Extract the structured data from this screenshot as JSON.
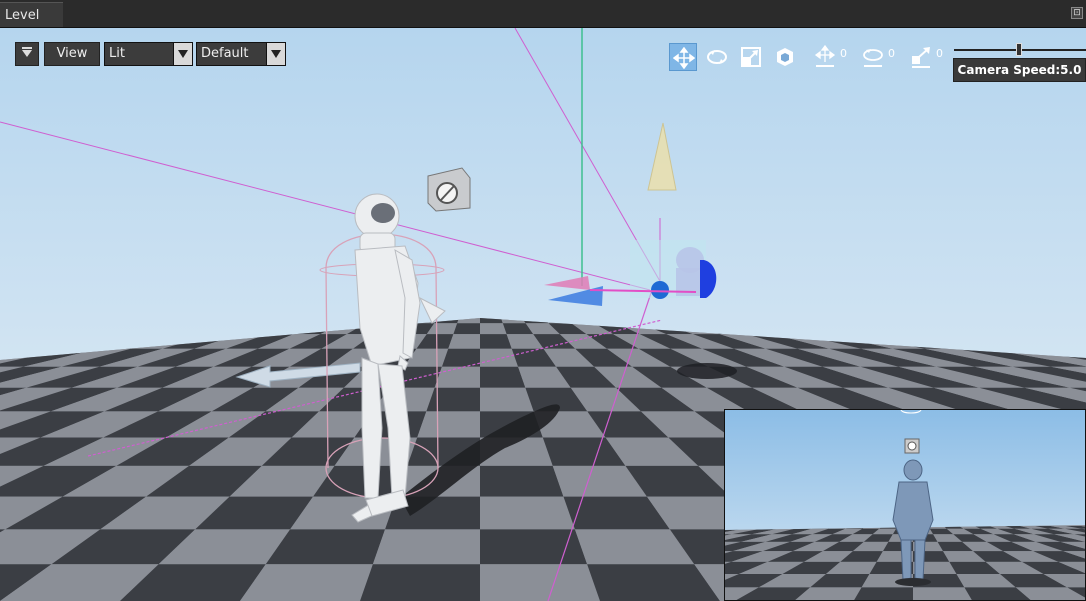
{
  "window": {
    "tab_title": "Level",
    "pin_glyph": "⊡"
  },
  "viewport": {
    "options_menu_icon": "viewport-options-icon",
    "view_button_label": "View",
    "lighting_mode": {
      "selected": "Lit"
    },
    "layout_mode": {
      "selected": "Default"
    },
    "tools": [
      {
        "name": "translate-tool-icon",
        "active": true
      },
      {
        "name": "rotate-tool-icon",
        "active": false
      },
      {
        "name": "scale-tool-icon",
        "active": false
      },
      {
        "name": "world-local-toggle-icon",
        "active": false
      }
    ],
    "snapping": {
      "translate": "0",
      "rotate": "0",
      "scale": "0"
    },
    "camera_speed_label": "Camera Speed:5.0",
    "camera_speed_value": 5.0
  },
  "colors": {
    "sky_top": "#b8d7ef",
    "sky_bottom": "#e4eef6",
    "floor_dark": "#3b3e44",
    "floor_light": "#8b8f97",
    "accent_active": "#7fb6e6",
    "selection_magenta": "#d66bd6",
    "gizmo_green": "#3fbf6f"
  }
}
